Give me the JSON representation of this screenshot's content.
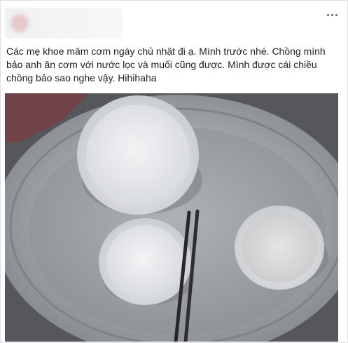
{
  "post": {
    "author_blurred": true,
    "more_icon": "more-options-icon",
    "text_lines": [
      "Các mẹ khoe mâm cơm ngày chủ nhật đi ạ. Mình trước nhé. Chồng mình",
      "bảo anh ăn cơm với nước lọc và muối cũng được. Mình được cái chiều",
      "chồng bảo sao nghe vậy. Hihihaha"
    ],
    "photo": {
      "subject": "tray-with-three-bowls-and-chopsticks"
    }
  },
  "colors": {
    "text": "#1c1e21",
    "border": "#dddfe2",
    "tray": "#9a9da2",
    "bowl": "#eceef0"
  }
}
